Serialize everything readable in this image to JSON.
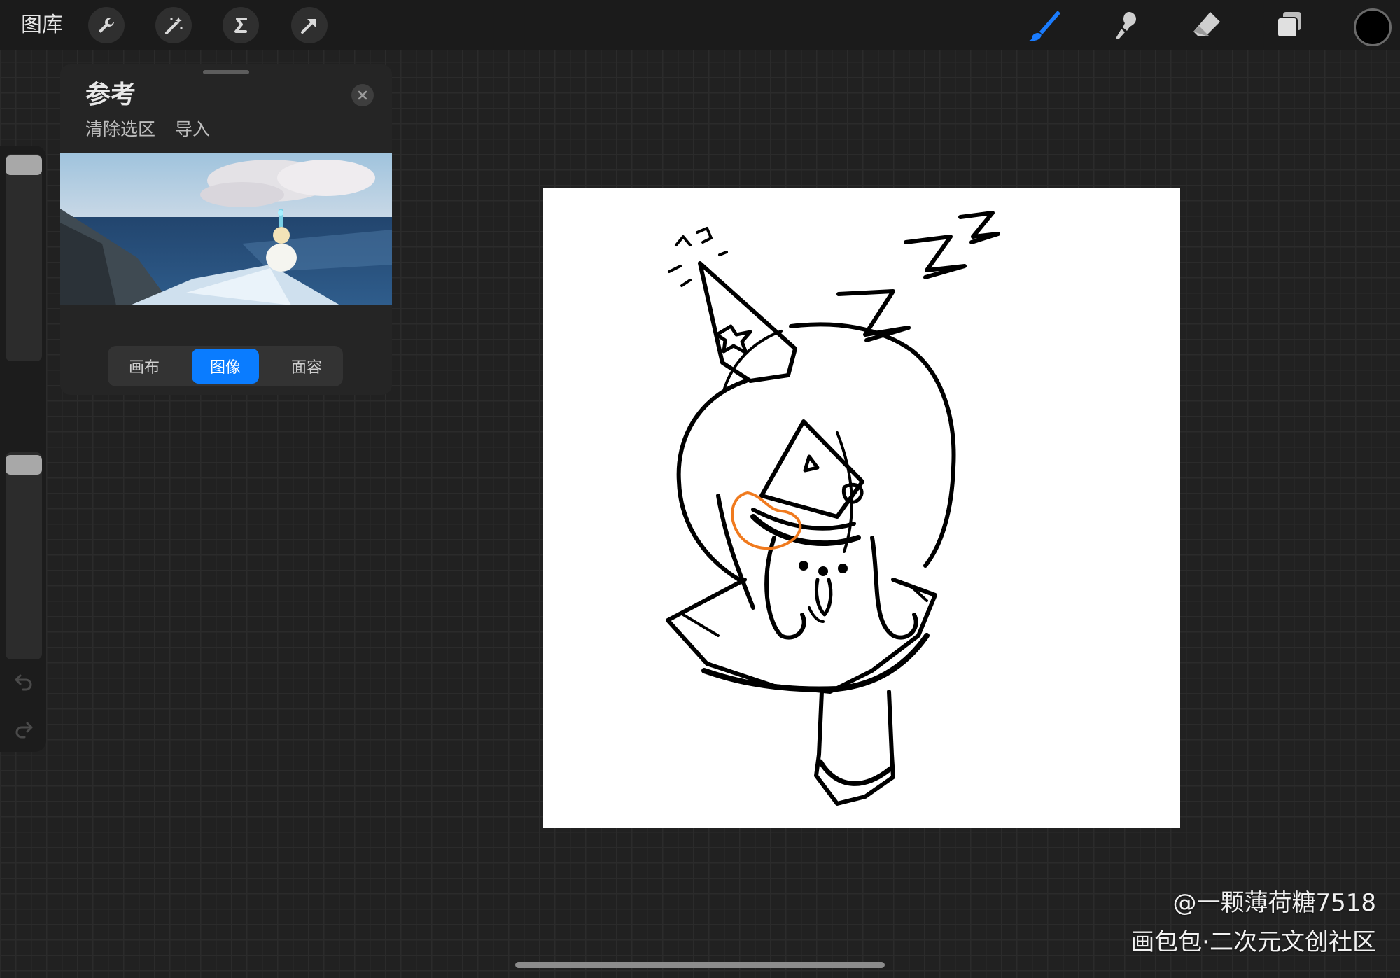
{
  "toolbar": {
    "gallery_label": "图库",
    "left_tools": [
      "wrench-icon",
      "magic-wand-icon",
      "selection-icon",
      "transform-arrow-icon"
    ],
    "right_tools": [
      "brush-icon",
      "smudge-icon",
      "eraser-icon",
      "layers-icon"
    ],
    "accent_color": "#1a7cff",
    "current_color": "#000000"
  },
  "reference_panel": {
    "title": "参考",
    "actions": [
      "清除选区",
      "导入"
    ],
    "segments": [
      {
        "label": "画布",
        "active": false
      },
      {
        "label": "图像",
        "active": true
      },
      {
        "label": "面容",
        "active": false
      }
    ]
  },
  "watermark": {
    "user": "@一颗薄荷糖7518",
    "site": "画包包·二次元文创社区"
  }
}
